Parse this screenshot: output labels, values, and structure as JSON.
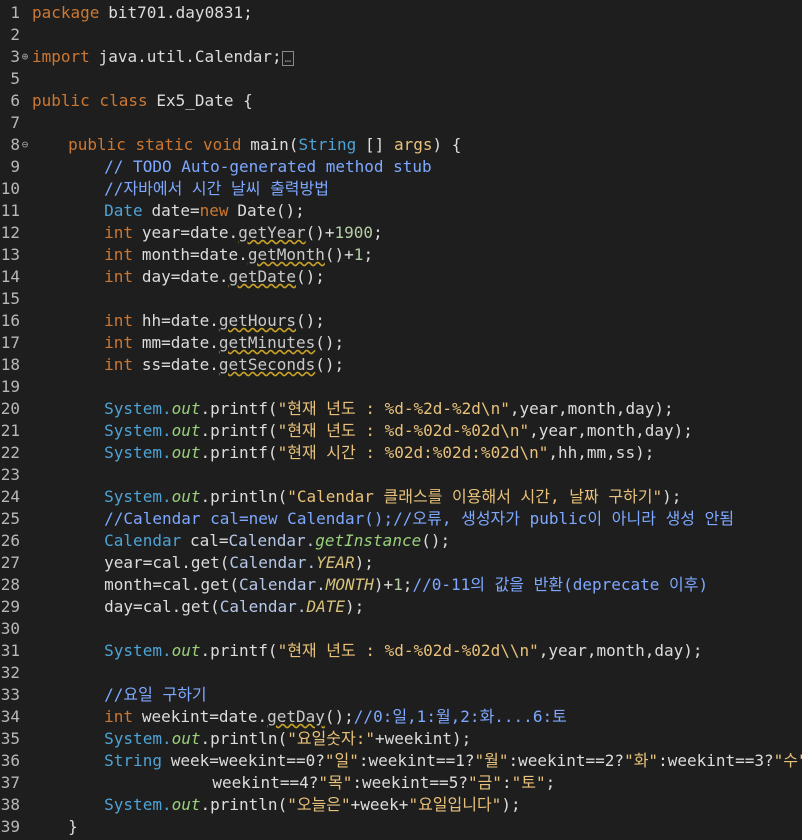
{
  "editor": {
    "lines": [
      {
        "n": "1",
        "segs": [
          [
            "kw",
            "package"
          ],
          [
            "",
            "bit701.day0831;"
          ]
        ]
      },
      {
        "n": "2",
        "segs": []
      },
      {
        "n": "3",
        "fold": "⊕",
        "segs": [
          [
            "kw",
            "import"
          ],
          [
            "",
            "java.util.Calendar;"
          ]
        ],
        "collapsed": "…"
      },
      {
        "n": "5",
        "segs": []
      },
      {
        "n": "6",
        "segs": [
          [
            "kw",
            "public class"
          ],
          [
            "",
            "Ex5_Date {"
          ]
        ]
      },
      {
        "n": "7",
        "segs": []
      },
      {
        "n": "8",
        "fold": "⊖",
        "segs": [
          [
            "kw",
            "public static void"
          ],
          [
            "",
            "main("
          ],
          [
            "ty",
            "String"
          ],
          [
            "",
            "[] "
          ],
          [
            "var",
            "args"
          ],
          [
            "",
            ") {"
          ]
        ]
      },
      {
        "n": "9",
        "segs": [
          [
            "cm",
            "// TODO Auto-generated method stub"
          ]
        ]
      },
      {
        "n": "10",
        "segs": [
          [
            "cm",
            "//자바에서 시간 날씨 출력방법"
          ]
        ]
      },
      {
        "n": "11",
        "segs": [
          [
            "ty",
            "Date"
          ],
          [
            "",
            "date="
          ],
          [
            "kw",
            "new"
          ],
          [
            "",
            "Date();"
          ]
        ]
      },
      {
        "n": "12",
        "segs": [
          [
            "kw",
            "int"
          ],
          [
            "",
            "year=date."
          ],
          [
            "dep",
            "getYear"
          ],
          [
            "",
            "()+"
          ],
          [
            "num",
            "1900"
          ],
          [
            "",
            ";"
          ]
        ]
      },
      {
        "n": "13",
        "segs": [
          [
            "kw",
            "int"
          ],
          [
            "",
            "month=date."
          ],
          [
            "dep",
            "getMonth"
          ],
          [
            "",
            "()+"
          ],
          [
            "num",
            "1"
          ],
          [
            "",
            ";"
          ]
        ]
      },
      {
        "n": "14",
        "segs": [
          [
            "kw",
            "int"
          ],
          [
            "",
            "day=date."
          ],
          [
            "dep",
            "getDate"
          ],
          [
            "",
            "();"
          ]
        ]
      },
      {
        "n": "15",
        "segs": []
      },
      {
        "n": "16",
        "segs": [
          [
            "kw",
            "int"
          ],
          [
            "",
            "hh=date."
          ],
          [
            "dep",
            "getHours"
          ],
          [
            "",
            "();"
          ]
        ]
      },
      {
        "n": "17",
        "segs": [
          [
            "kw",
            "int"
          ],
          [
            "",
            "mm=date."
          ],
          [
            "dep",
            "getMinutes"
          ],
          [
            "",
            "();"
          ]
        ]
      },
      {
        "n": "18",
        "segs": [
          [
            "kw",
            "int"
          ],
          [
            "",
            "ss=date."
          ],
          [
            "dep",
            "getSeconds"
          ],
          [
            "",
            "();"
          ]
        ]
      },
      {
        "n": "19",
        "segs": []
      },
      {
        "n": "20",
        "segs": [
          [
            "ty",
            "System."
          ],
          [
            "it",
            "out"
          ],
          [
            "",
            ".printf("
          ],
          [
            "str",
            "\"현재 년도 : %d-%2d-%2d\\n\""
          ],
          [
            "",
            ",year,month,day);"
          ]
        ]
      },
      {
        "n": "21",
        "segs": [
          [
            "ty",
            "System."
          ],
          [
            "it",
            "out"
          ],
          [
            "",
            ".printf("
          ],
          [
            "str",
            "\"현재 년도 : %d-%02d-%02d\\n\""
          ],
          [
            "",
            ",year,month,day);"
          ]
        ]
      },
      {
        "n": "22",
        "segs": [
          [
            "ty",
            "System."
          ],
          [
            "it",
            "out"
          ],
          [
            "",
            ".printf("
          ],
          [
            "str",
            "\"현재 시간 : %02d:%02d:%02d\\n\""
          ],
          [
            "",
            ",hh,mm,ss);"
          ]
        ]
      },
      {
        "n": "23",
        "segs": []
      },
      {
        "n": "24",
        "segs": [
          [
            "ty",
            "System."
          ],
          [
            "it",
            "out"
          ],
          [
            "",
            ".println("
          ],
          [
            "str",
            "\"Calendar 클래스를 이용해서 시간, 날짜 구하기\""
          ],
          [
            "",
            ");"
          ]
        ]
      },
      {
        "n": "25",
        "segs": [
          [
            "cm",
            "//Calendar cal=new Calendar();//오류, 생성자가 public이 아니라 생성 안됨"
          ]
        ]
      },
      {
        "n": "26",
        "segs": [
          [
            "ty",
            "Calendar"
          ],
          [
            "",
            "cal="
          ],
          [
            "cls",
            "Calendar."
          ],
          [
            "it",
            "getInstance"
          ],
          [
            "",
            "();"
          ]
        ]
      },
      {
        "n": "27",
        "segs": [
          [
            "",
            "year=cal.get("
          ],
          [
            "cls",
            "Calendar."
          ],
          [
            "itc",
            "YEAR"
          ],
          [
            "",
            ");"
          ]
        ]
      },
      {
        "n": "28",
        "segs": [
          [
            "",
            "month=cal.get("
          ],
          [
            "cls",
            "Calendar."
          ],
          [
            "itc",
            "MONTH"
          ],
          [
            "",
            ")+"
          ],
          [
            "num",
            "1"
          ],
          [
            "",
            ";"
          ],
          [
            "cm",
            "//0-11의 값을 반환(deprecate 이후)"
          ]
        ]
      },
      {
        "n": "29",
        "segs": [
          [
            "",
            "day=cal.get("
          ],
          [
            "cls",
            "Calendar."
          ],
          [
            "itc",
            "DATE"
          ],
          [
            "",
            ");"
          ]
        ]
      },
      {
        "n": "30",
        "segs": []
      },
      {
        "n": "31",
        "segs": [
          [
            "ty",
            "System."
          ],
          [
            "it",
            "out"
          ],
          [
            "",
            ".printf("
          ],
          [
            "str",
            "\"현재 년도 : %d-%02d-%02d\\\\n\""
          ],
          [
            "",
            ",year,month,day);"
          ]
        ]
      },
      {
        "n": "32",
        "segs": []
      },
      {
        "n": "33",
        "segs": [
          [
            "cm",
            "//요일 구하기"
          ]
        ]
      },
      {
        "n": "34",
        "segs": [
          [
            "kw",
            "int"
          ],
          [
            "",
            "weekint=date."
          ],
          [
            "dep",
            "getDay"
          ],
          [
            "",
            "();"
          ],
          [
            "cm",
            "//0:일,1:월,2:화....6:토"
          ]
        ]
      },
      {
        "n": "35",
        "segs": [
          [
            "ty",
            "System."
          ],
          [
            "it",
            "out"
          ],
          [
            "",
            ".println("
          ],
          [
            "str",
            "\"요일숫자:\""
          ],
          [
            "",
            "+weekint);"
          ]
        ]
      },
      {
        "n": "36",
        "segs": [
          [
            "ty",
            "String"
          ],
          [
            "",
            "week=weekint==0?"
          ],
          [
            "str",
            "\"일\""
          ],
          [
            "",
            ":weekint==1?"
          ],
          [
            "str",
            "\"월\""
          ],
          [
            "",
            ":weekint==2?"
          ],
          [
            "str",
            "\"화\""
          ],
          [
            "",
            ":weekint==3?"
          ],
          [
            "str",
            "\"수\""
          ],
          [
            "",
            ":"
          ]
        ]
      },
      {
        "n": "37",
        "segs": [
          [
            "",
            "weekint==4?"
          ],
          [
            "str",
            "\"목\""
          ],
          [
            "",
            ":weekint==5?"
          ],
          [
            "str",
            "\"금\""
          ],
          [
            "",
            ":"
          ],
          [
            "str",
            "\"토\""
          ],
          [
            "",
            ";"
          ]
        ]
      },
      {
        "n": "38",
        "segs": [
          [
            "ty",
            "System."
          ],
          [
            "it",
            "out"
          ],
          [
            "",
            ".println("
          ],
          [
            "str",
            "\"오늘은\""
          ],
          [
            "",
            "+week+"
          ],
          [
            "str",
            "\"요일입니다\""
          ],
          [
            "",
            ");"
          ]
        ]
      },
      {
        "n": "39",
        "segs": [
          [
            "",
            "}"
          ]
        ]
      }
    ]
  }
}
